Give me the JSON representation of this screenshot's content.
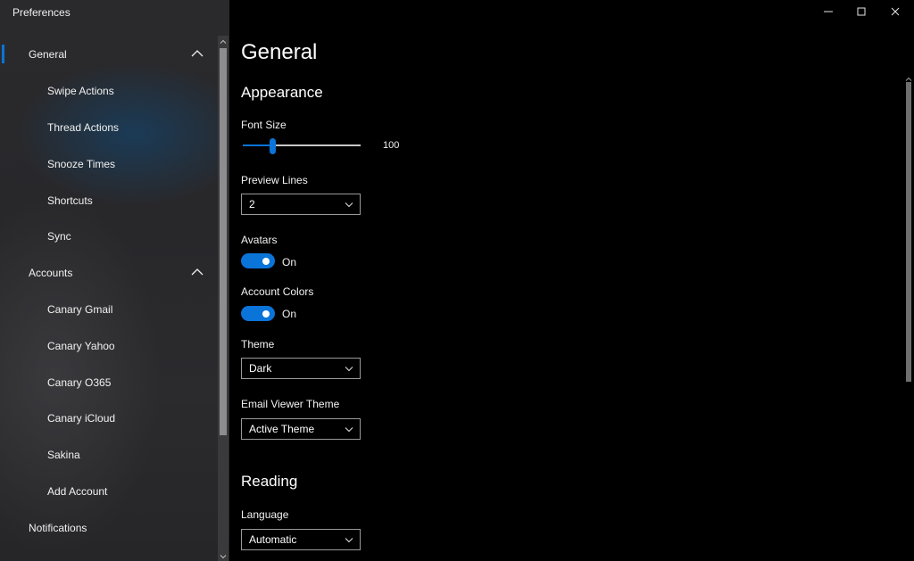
{
  "window": {
    "title": "Preferences",
    "controls": [
      "minimize-icon",
      "maximize-icon",
      "close-icon"
    ]
  },
  "sidebar": {
    "items": [
      {
        "label": "General",
        "type": "group",
        "selected": true,
        "expanded": true
      },
      {
        "label": "Swipe Actions",
        "type": "child"
      },
      {
        "label": "Thread Actions",
        "type": "child"
      },
      {
        "label": "Snooze Times",
        "type": "child"
      },
      {
        "label": "Shortcuts",
        "type": "child"
      },
      {
        "label": "Sync",
        "type": "child"
      },
      {
        "label": "Accounts",
        "type": "group",
        "expanded": true
      },
      {
        "label": "Canary Gmail",
        "type": "child"
      },
      {
        "label": "Canary Yahoo",
        "type": "child"
      },
      {
        "label": "Canary O365",
        "type": "child"
      },
      {
        "label": "Canary iCloud",
        "type": "child"
      },
      {
        "label": "Sakina",
        "type": "child"
      },
      {
        "label": "Add Account",
        "type": "child"
      },
      {
        "label": "Notifications",
        "type": "group"
      }
    ]
  },
  "main": {
    "title": "General",
    "appearance": {
      "heading": "Appearance",
      "font_size": {
        "label": "Font Size",
        "value": "100",
        "slider_fraction": 0.25
      },
      "preview_lines": {
        "label": "Preview Lines",
        "value": "2"
      },
      "avatars": {
        "label": "Avatars",
        "state": "On"
      },
      "account_colors": {
        "label": "Account Colors",
        "state": "On"
      },
      "theme": {
        "label": "Theme",
        "value": "Dark"
      },
      "email_viewer_theme": {
        "label": "Email Viewer Theme",
        "value": "Active Theme"
      }
    },
    "reading": {
      "heading": "Reading",
      "language": {
        "label": "Language",
        "value": "Automatic"
      }
    }
  },
  "colors": {
    "accent": "#0A74D8",
    "background": "#000000",
    "sidebar": "#2A2A2D"
  }
}
